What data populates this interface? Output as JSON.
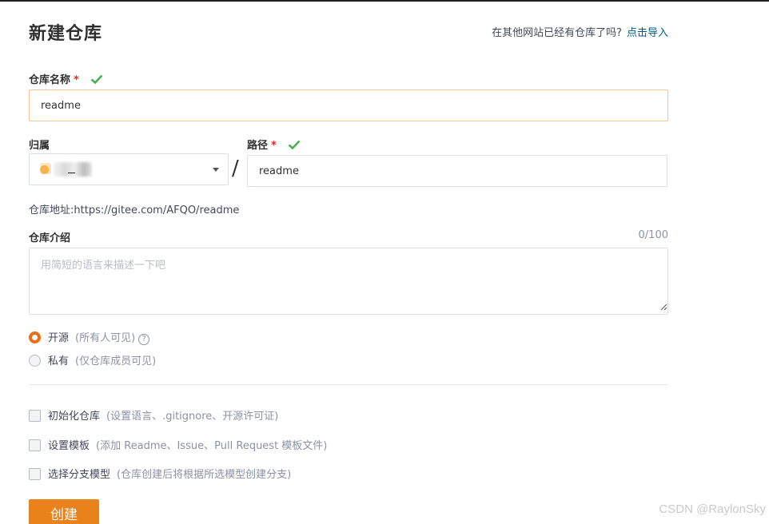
{
  "page": {
    "title": "新建仓库",
    "import_hint": "在其他网站已经有仓库了吗?",
    "import_link": "点击导入"
  },
  "repo_name": {
    "label": "仓库名称",
    "required_mark": "*",
    "value": "readme",
    "status_icon": "check-icon",
    "status_color": "#4caf50"
  },
  "owner": {
    "label": "归属",
    "selected": "_"
  },
  "separator": "/",
  "path": {
    "label": "路径",
    "required_mark": "*",
    "value": "readme",
    "status_icon": "check-icon"
  },
  "repo_address": {
    "prefix": "仓库地址:",
    "url": "https://gitee.com/AFQO/readme"
  },
  "description": {
    "label": "仓库介绍",
    "counter": "0/100",
    "placeholder": "用简短的语言来描述一下吧",
    "value": ""
  },
  "visibility": {
    "options": [
      {
        "label": "开源",
        "hint": "(所有人可见)",
        "selected": true,
        "help": "?"
      },
      {
        "label": "私有",
        "hint": "(仅仓库成员可见)",
        "selected": false
      }
    ]
  },
  "options": [
    {
      "label": "初始化仓库",
      "hint": "(设置语言、.gitignore、开源许可证)",
      "checked": false
    },
    {
      "label": "设置模板",
      "hint": "(添加 Readme、Issue、Pull Request 模板文件)",
      "checked": false
    },
    {
      "label": "选择分支模型",
      "hint": "(仓库创建后将根据所选模型创建分支)",
      "checked": false
    }
  ],
  "submit": {
    "label": "创建",
    "color": "#e9821a"
  },
  "watermark": "CSDN @RaylonSky",
  "colors": {
    "accent": "#e96f16",
    "link": "#005980",
    "required": "#e52a2a"
  }
}
